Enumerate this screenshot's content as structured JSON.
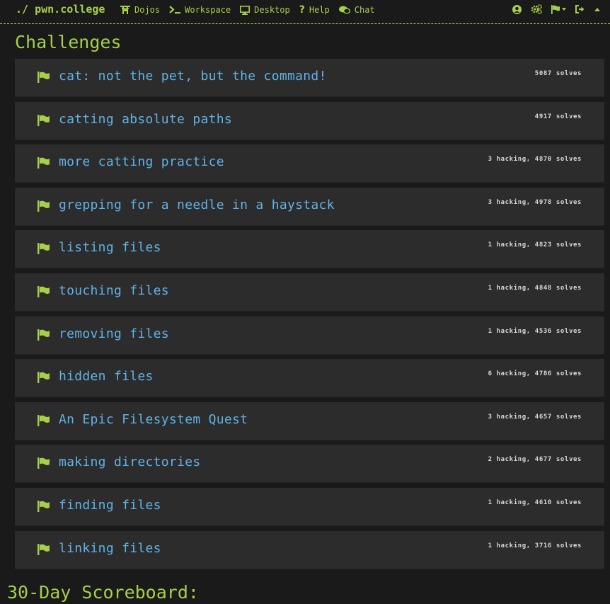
{
  "nav": {
    "brand": "./ pwn.college",
    "items": [
      {
        "label": "Dojos",
        "icon": "dojo-icon"
      },
      {
        "label": "Workspace",
        "icon": "terminal-icon"
      },
      {
        "label": "Desktop",
        "icon": "monitor-icon"
      },
      {
        "label": "Help",
        "icon": "question-icon"
      },
      {
        "label": "Chat",
        "icon": "chat-icon"
      }
    ],
    "right_icons": [
      "user-circle-icon",
      "cogs-icon",
      "flag-dropdown-icon",
      "sign-out-icon",
      "caret-up-icon"
    ]
  },
  "main": {
    "title": "Challenges",
    "challenges": [
      {
        "name": "cat: not the pet, but the command!",
        "stats": "5087 solves"
      },
      {
        "name": "catting absolute paths",
        "stats": "4917 solves"
      },
      {
        "name": "more catting practice",
        "stats": "3 hacking, 4870 solves"
      },
      {
        "name": "grepping for a needle in a haystack",
        "stats": "3 hacking, 4978 solves"
      },
      {
        "name": "listing files",
        "stats": "1 hacking, 4823 solves"
      },
      {
        "name": "touching files",
        "stats": "1 hacking, 4848 solves"
      },
      {
        "name": "removing files",
        "stats": "1 hacking, 4536 solves"
      },
      {
        "name": "hidden files",
        "stats": "6 hacking, 4786 solves"
      },
      {
        "name": "An Epic Filesystem Quest",
        "stats": "3 hacking, 4657 solves"
      },
      {
        "name": "making directories",
        "stats": "2 hacking, 4677 solves"
      },
      {
        "name": "finding files",
        "stats": "1 hacking, 4610 solves"
      },
      {
        "name": "linking files",
        "stats": "1 hacking, 3716 solves"
      }
    ],
    "scoreboard_title": "30-Day Scoreboard:"
  },
  "colors": {
    "accent": "#a6d04a",
    "challenge_name": "#5fb3e8",
    "row_bg": "#2c2c2c",
    "page_bg": "#1a1a1a"
  }
}
